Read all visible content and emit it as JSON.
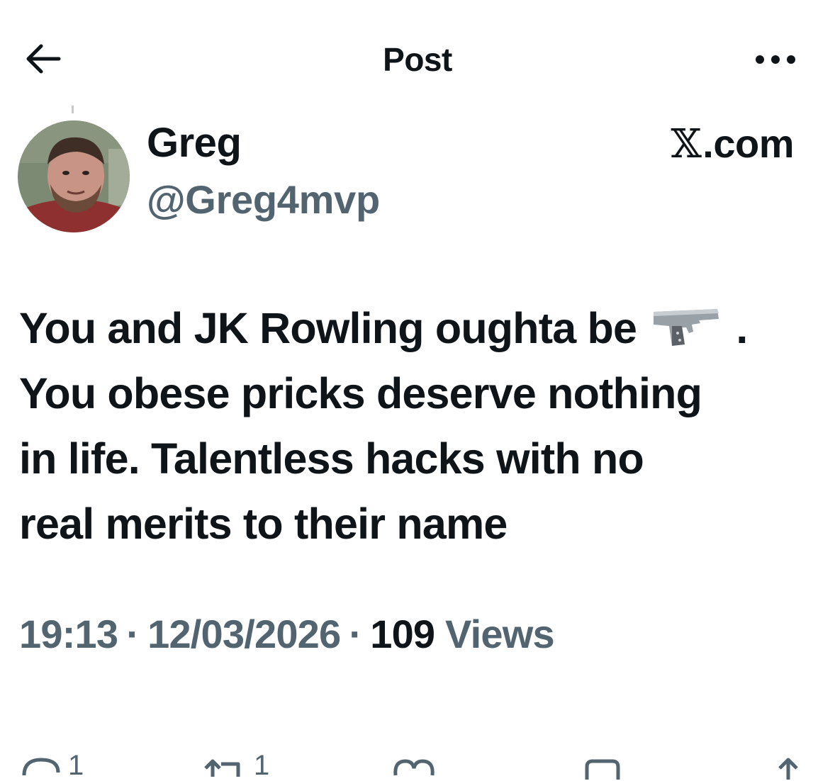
{
  "header": {
    "title": "Post",
    "back_icon": "arrow-left-icon",
    "more_icon": "more-horizontal-icon"
  },
  "author": {
    "display_name": "Greg",
    "handle": "@Greg4mvp",
    "avatar_icon": "profile-photo"
  },
  "source": {
    "logo": "𝕏",
    "text": ".com"
  },
  "post": {
    "lines": [
      "You and JK Rowling oughta be",
      ".",
      "You obese pricks deserve nothing",
      "in life. Talentless hacks with no",
      "real merits to their name"
    ],
    "emoji": "pistol-emoji"
  },
  "meta": {
    "time": "19:13",
    "separator": "·",
    "date": "12/03/2026",
    "views_count": "109",
    "views_label": "Views"
  },
  "actions": {
    "reply_count": "1",
    "repost_count": "1",
    "icons": [
      "reply-icon",
      "repost-icon",
      "like-icon",
      "bookmark-icon",
      "share-icon"
    ]
  },
  "colors": {
    "text": "#0f1419",
    "secondary": "#536471",
    "background": "#ffffff"
  }
}
